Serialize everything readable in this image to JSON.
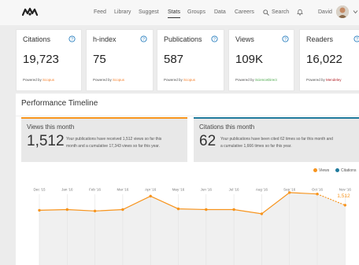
{
  "nav": {
    "items": [
      "Feed",
      "Library",
      "Suggest",
      "Stats",
      "Groups",
      "Data",
      "Careers"
    ],
    "active": "Stats",
    "search_label": "Search",
    "user_name": "David"
  },
  "cards": [
    {
      "title": "Citations",
      "value": "19,723",
      "powered_prefix": "Powered by",
      "powered_source": "Scopus",
      "source_color": "#f47f2a"
    },
    {
      "title": "h-index",
      "value": "75",
      "powered_prefix": "Powered by",
      "powered_source": "Scopus",
      "source_color": "#f47f2a"
    },
    {
      "title": "Publications",
      "value": "587",
      "powered_prefix": "Powered by",
      "powered_source": "Scopus",
      "source_color": "#f47f2a"
    },
    {
      "title": "Views",
      "value": "109K",
      "powered_prefix": "Powered by",
      "powered_source": "ScienceDirect",
      "source_color": "#4aa84a"
    },
    {
      "title": "Readers",
      "value": "16,022",
      "powered_prefix": "Powered by",
      "powered_source": "Mendeley",
      "source_color": "#b3262c"
    }
  ],
  "performance": {
    "title": "Performance Timeline",
    "views_panel": {
      "title": "Views this month",
      "value": "1,512",
      "desc_line1": "Your publications have received 1,512 views so far this",
      "desc_line2": "month and a cumulative 17,343 views so far this year."
    },
    "citations_panel": {
      "title": "Citations this month",
      "value": "62",
      "desc_line1": "Your publications have been cited 62 times so far this month and",
      "desc_line2": "a cumulative 1,666 times so far this year."
    },
    "legend": {
      "views_label": "Views",
      "citations_label": "Citations"
    }
  },
  "colors": {
    "views": "#f7941d",
    "citations": "#1f7a9c",
    "info_icon": "#2a7fbf"
  },
  "chart_data": {
    "type": "line",
    "x": [
      "Dec '15",
      "Jan '16",
      "Feb '16",
      "Mar '16",
      "Apr '16",
      "May '16",
      "Jun '16",
      "Jul '16",
      "Aug '16",
      "Sep '16",
      "Oct '16",
      "Nov '16"
    ],
    "series": [
      {
        "name": "Views",
        "values": [
          1440,
          1450,
          1430,
          1450,
          1640,
          1460,
          1450,
          1450,
          1390,
          1690,
          1670,
          1512
        ]
      }
    ],
    "last_label": "1,512",
    "ylim": [
      1000,
      2000
    ],
    "grid": true
  }
}
